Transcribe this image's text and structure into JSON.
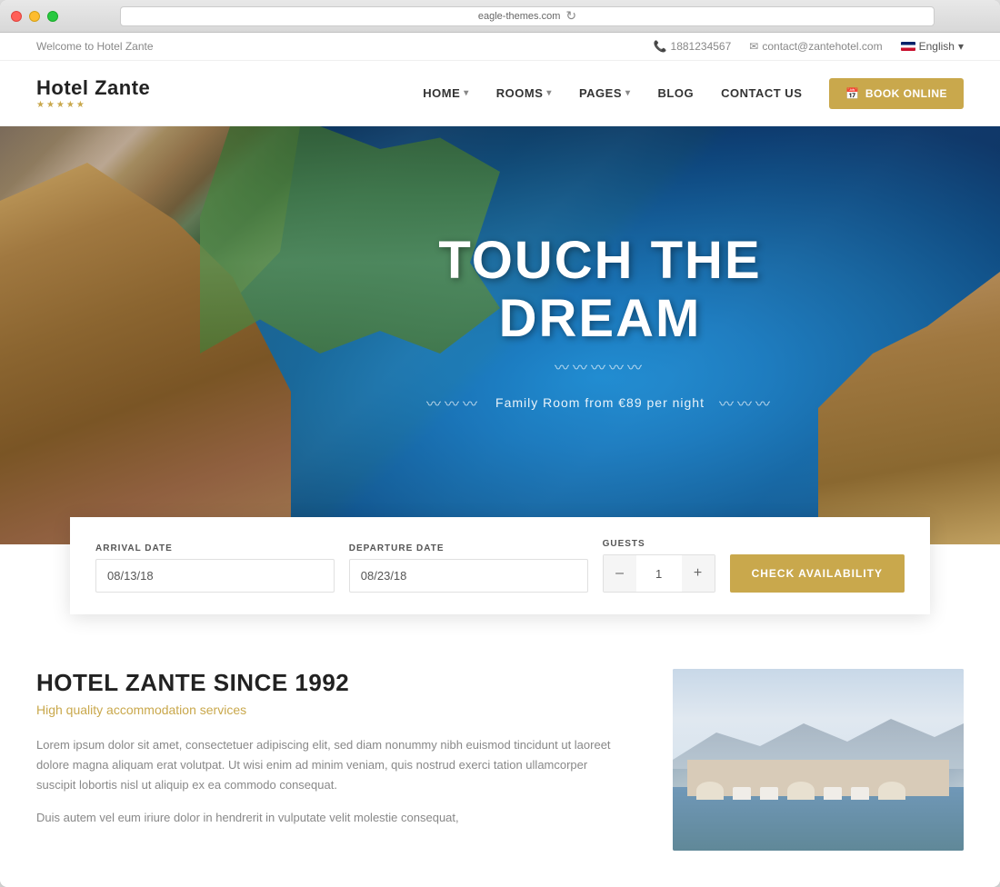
{
  "browser": {
    "url": "eagle-themes.com",
    "refresh_icon": "↻"
  },
  "topbar": {
    "welcome": "Welcome to Hotel Zante",
    "phone": "1881234567",
    "phone_icon": "📞",
    "email": "contact@zantehotel.com",
    "email_icon": "✉",
    "language": "English",
    "lang_arrow": "▾"
  },
  "header": {
    "logo_name": "Hotel Zante",
    "logo_stars": "★★★★★",
    "nav": [
      {
        "id": "home",
        "label": "HOME",
        "has_arrow": true
      },
      {
        "id": "rooms",
        "label": "ROOMS",
        "has_arrow": true
      },
      {
        "id": "pages",
        "label": "PAGES",
        "has_arrow": true
      },
      {
        "id": "blog",
        "label": "BLOG",
        "has_arrow": false
      },
      {
        "id": "contact",
        "label": "CONTACT US",
        "has_arrow": false
      }
    ],
    "book_btn": "BOOK ONLINE",
    "book_icon": "📅"
  },
  "hero": {
    "title": "TOUCH THE DREAM",
    "wave": "〰〰〰〰",
    "subtitle": "Family Room from €89 per night",
    "wave2": "〰〰〰〰"
  },
  "booking": {
    "arrival_label": "ARRIVAL DATE",
    "arrival_value": "08/13/18",
    "departure_label": "DEPARTURE DATE",
    "departure_value": "08/23/18",
    "guests_label": "GUESTS",
    "guests_value": "1",
    "minus": "–",
    "plus": "+",
    "check_btn": "CHECK AVAILABILITY"
  },
  "content": {
    "title": "HOTEL ZANTE SINCE 1992",
    "subtitle": "High quality accommodation services",
    "text1": "Lorem ipsum dolor sit amet, consectetuer adipiscing elit, sed diam nonummy nibh euismod tincidunt ut laoreet dolore magna aliquam erat volutpat. Ut wisi enim ad minim veniam, quis nostrud exerci tation ullamcorper suscipit lobortis nisl ut aliquip ex ea commodo consequat.",
    "text2": "Duis autem vel eum iriure dolor in hendrerit in vulputate velit molestie consequat,"
  }
}
